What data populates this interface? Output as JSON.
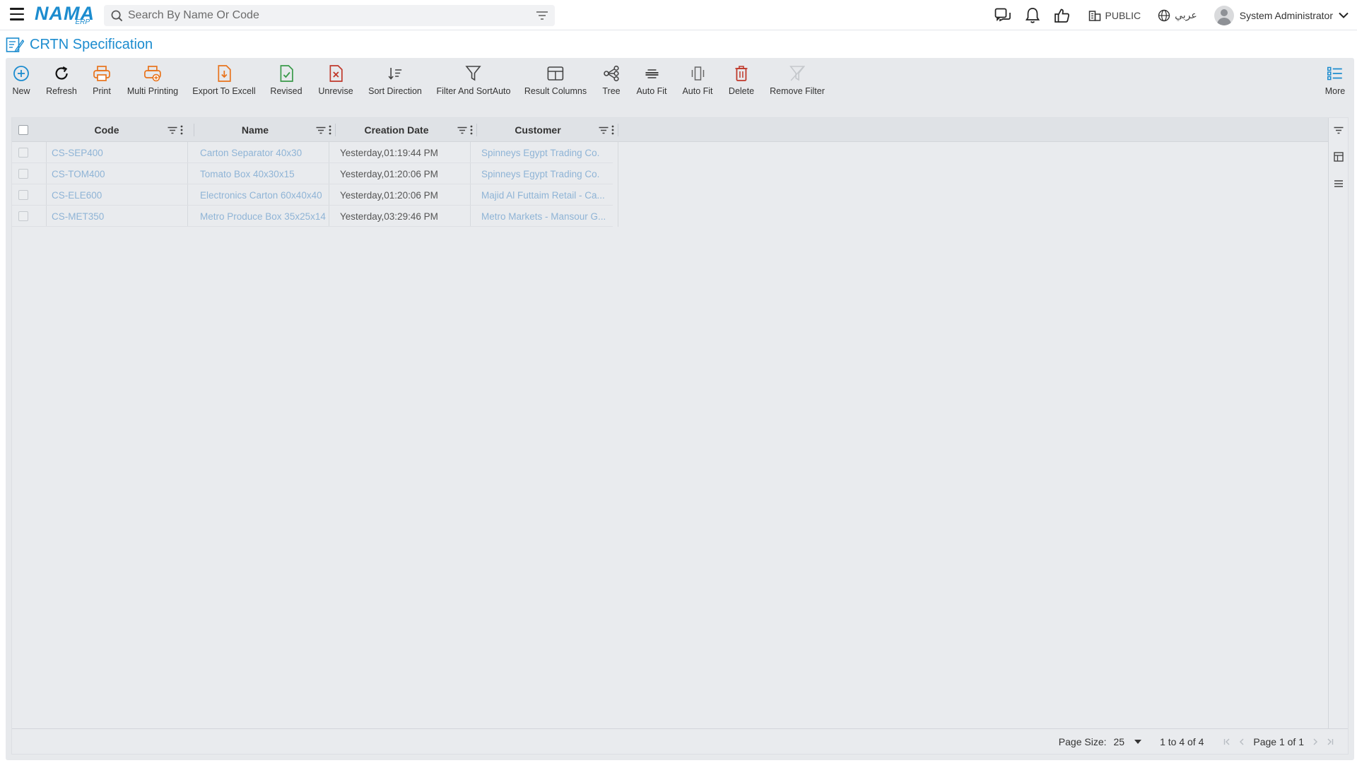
{
  "topbar": {
    "brand": "NAMA",
    "brand_sub": "ERP",
    "search_placeholder": "Search By Name Or Code",
    "public_label": "PUBLIC",
    "language_label": "عربي",
    "user_name": "System Administrator"
  },
  "page": {
    "title": "CRTN Specification"
  },
  "toolbar": {
    "new": "New",
    "refresh": "Refresh",
    "print": "Print",
    "multi_printing": "Multi Printing",
    "export_excel": "Export To Excell",
    "revised": "Revised",
    "unrevise": "Unrevise",
    "sort_direction": "Sort Direction",
    "filter_sort": "Filter And SortAuto",
    "result_columns": "Result Columns",
    "tree": "Tree",
    "auto_fit_1": "Auto Fit",
    "auto_fit_2": "Auto Fit",
    "delete": "Delete",
    "remove_filter": "Remove Filter",
    "more": "More"
  },
  "grid": {
    "columns": [
      "Code",
      "Name",
      "Creation Date",
      "Customer"
    ],
    "rows": [
      {
        "code": "CS-SEP400",
        "name": "Carton Separator 40x30",
        "date": "Yesterday,01:19:44 PM",
        "customer": "Spinneys Egypt Trading Co."
      },
      {
        "code": "CS-TOM400",
        "name": "Tomato Box 40x30x15",
        "date": "Yesterday,01:20:06 PM",
        "customer": "Spinneys Egypt Trading Co."
      },
      {
        "code": "CS-ELE600",
        "name": "Electronics Carton 60x40x40",
        "date": "Yesterday,01:20:06 PM",
        "customer": "Majid Al Futtaim Retail - Ca..."
      },
      {
        "code": "CS-MET350",
        "name": "Metro Produce Box 35x25x14",
        "date": "Yesterday,03:29:46 PM",
        "customer": "Metro Markets - Mansour G..."
      }
    ]
  },
  "footer": {
    "page_size_label": "Page Size:",
    "page_size_value": "25",
    "range_text": "1 to 4 of 4",
    "page_text": "Page 1 of 1"
  },
  "colors": {
    "accent": "#1c8ccf",
    "orange": "#e8731c",
    "green": "#3a9a4a",
    "red": "#c0392b",
    "link_muted": "#8fb4d6"
  }
}
